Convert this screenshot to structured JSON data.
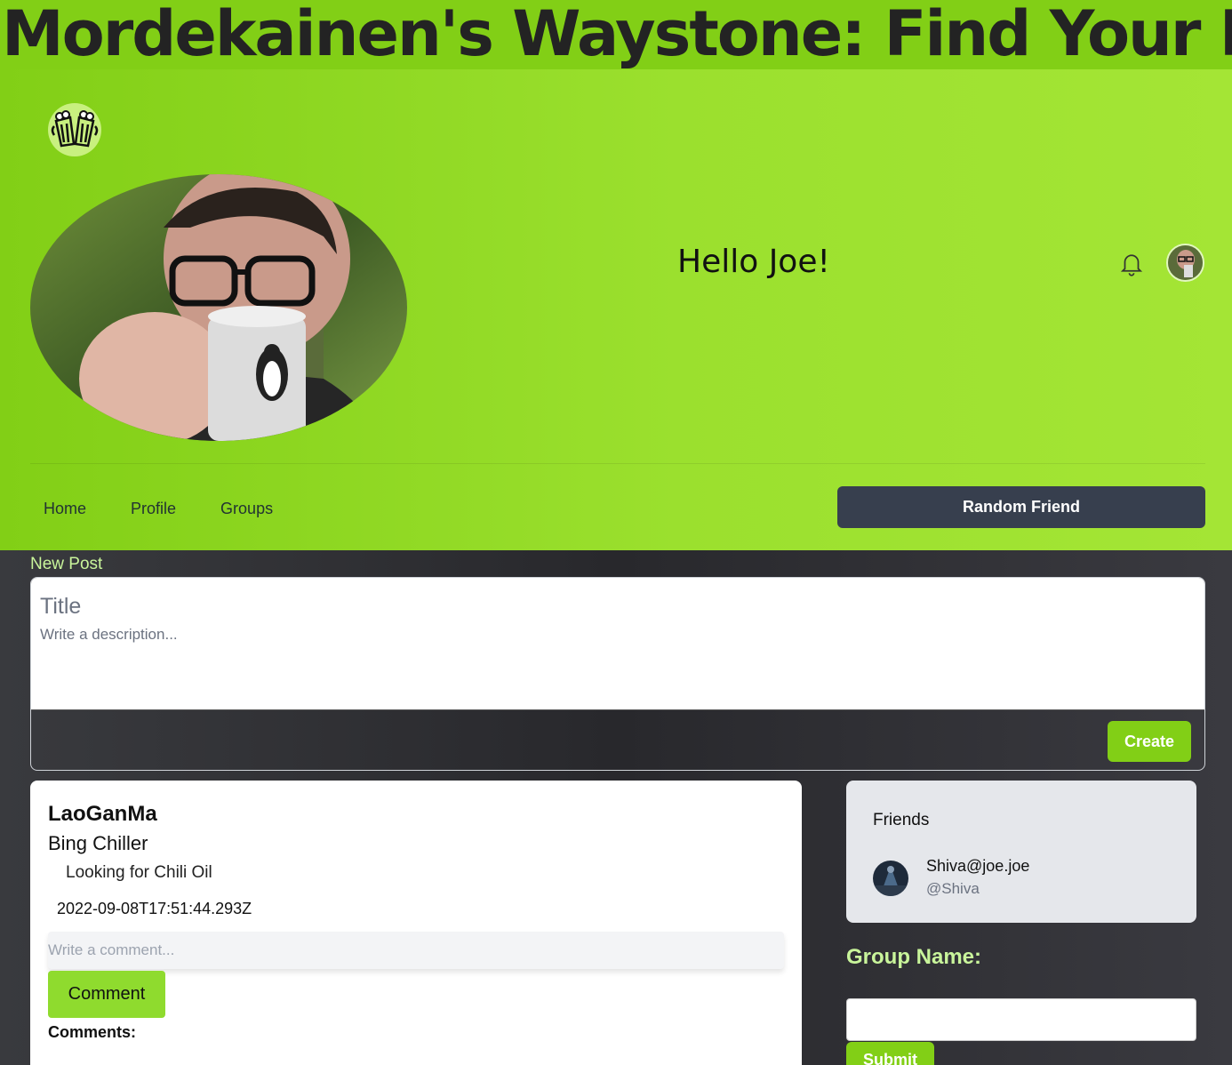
{
  "app": {
    "title": "Mordekainen's Waystone: Find Your Party"
  },
  "header": {
    "logo_icon": "beer-mugs-icon",
    "greeting": "Hello Joe!",
    "notification_icon": "bell-icon"
  },
  "nav": {
    "items": [
      {
        "label": "Home"
      },
      {
        "label": "Profile"
      },
      {
        "label": "Groups"
      }
    ],
    "random_friend_label": "Random Friend"
  },
  "new_post": {
    "label": "New Post",
    "title_placeholder": "Title",
    "description_placeholder": "Write a description...",
    "create_label": "Create"
  },
  "post": {
    "author": "LaoGanMa",
    "title": "Bing Chiller",
    "description": "Looking for Chili Oil",
    "date": "2022-09-08T17:51:44.293Z",
    "comment_placeholder": "Write a comment...",
    "comment_button": "Comment",
    "comments_label": "Comments:"
  },
  "friends": {
    "title": "Friends",
    "items": [
      {
        "name": "Shiva@joe.joe",
        "handle": "@Shiva"
      }
    ]
  },
  "group": {
    "label": "Group Name:",
    "submit_label": "Submit"
  },
  "colors": {
    "brand_green": "#82cf16",
    "dark_button": "#373f4e",
    "accent_text": "#c9f59b"
  }
}
